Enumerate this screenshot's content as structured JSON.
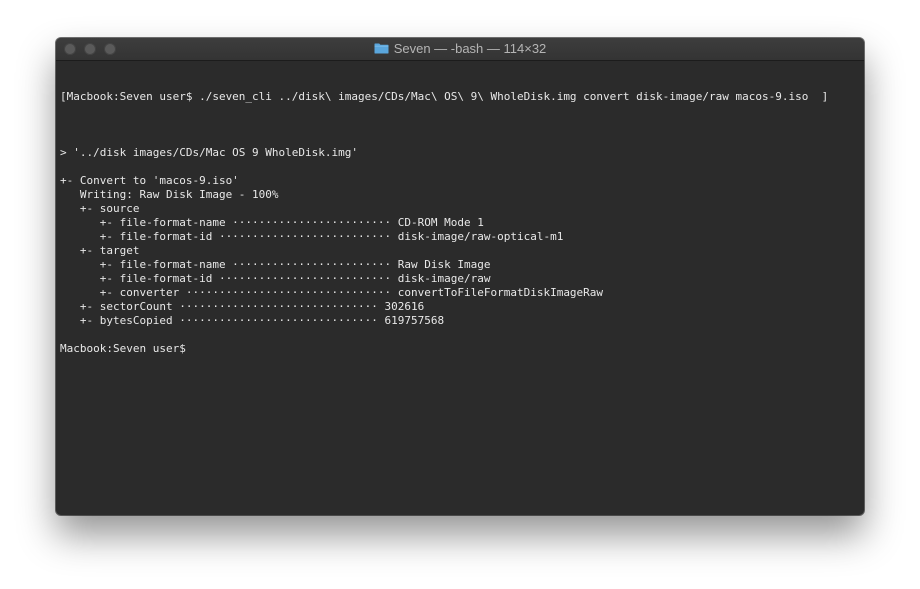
{
  "window": {
    "title": "Seven — -bash — 114×32",
    "folder_icon": "folder-icon",
    "controls": {
      "close": "close-button",
      "minimize": "minimize-button",
      "zoom": "zoom-button"
    }
  },
  "terminal": {
    "command_line": "[Macbook:Seven user$ ./seven_cli ../disk\\ images/CDs/Mac\\ OS\\ 9\\ WholeDisk.img convert disk-image/raw macos-9.iso  ]",
    "lines": [
      "",
      "> '../disk images/CDs/Mac OS 9 WholeDisk.img'",
      "",
      "+- Convert to 'macos-9.iso'",
      "   Writing: Raw Disk Image - 100%",
      "   +- source",
      "      +- file-format-name ························ CD-ROM Mode 1",
      "      +- file-format-id ·························· disk-image/raw-optical-m1",
      "   +- target",
      "      +- file-format-name ························ Raw Disk Image",
      "      +- file-format-id ·························· disk-image/raw",
      "      +- converter ······························· convertToFileFormatDiskImageRaw",
      "   +- sectorCount ······························ 302616",
      "   +- bytesCopied ······························ 619757568",
      "",
      "Macbook:Seven user$"
    ]
  },
  "colors": {
    "background": "#2b2b2b",
    "titlebar": "#383838",
    "text": "#e8e8e8",
    "title_text": "#b4b4b4",
    "traffic_inactive": "#5a5a5a",
    "folder": "#5aa6dc"
  }
}
